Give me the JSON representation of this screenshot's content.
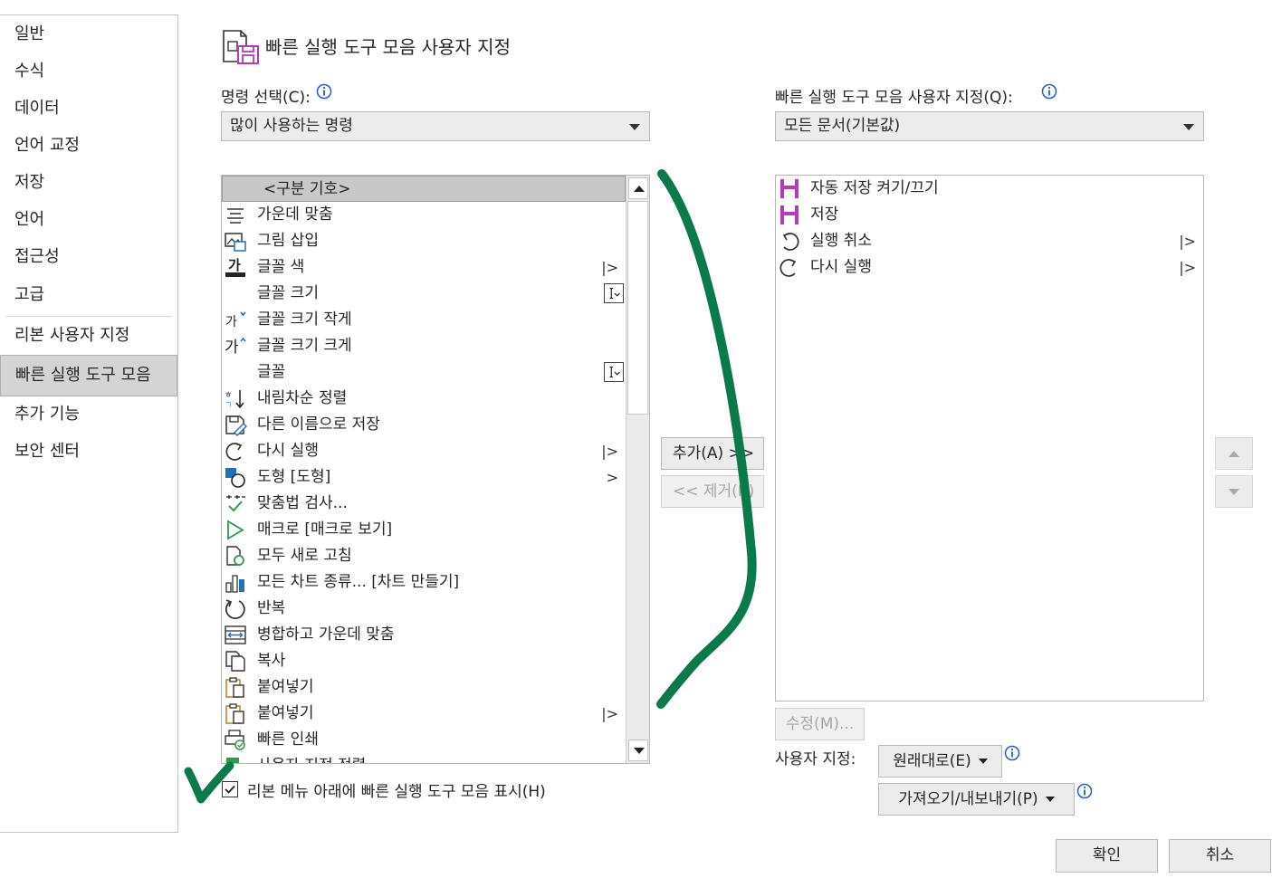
{
  "sidebar": {
    "items": [
      {
        "label": "일반"
      },
      {
        "label": "수식"
      },
      {
        "label": "데이터"
      },
      {
        "label": "언어 교정"
      },
      {
        "label": "저장"
      },
      {
        "label": "언어"
      },
      {
        "label": "접근성"
      },
      {
        "label": "고급"
      },
      {
        "label": "리본 사용자 지정"
      },
      {
        "label": "빠른 실행 도구 모음",
        "selected": true
      },
      {
        "label": "추가 기능"
      },
      {
        "label": "보안 센터"
      }
    ]
  },
  "header": {
    "title": "빠른 실행 도구 모음 사용자 지정"
  },
  "left": {
    "choose_label": "명령 선택(C):",
    "choose_value": "많이 사용하는 명령",
    "commands": [
      {
        "label": "<구분 기호>",
        "icon": "none",
        "selected": true
      },
      {
        "label": "가운데 맞춤",
        "icon": "align-center-icon"
      },
      {
        "label": "그림 삽입",
        "icon": "insert-picture-icon"
      },
      {
        "label": "글꼴 색",
        "icon": "font-color-icon",
        "extra": "|>"
      },
      {
        "label": "글꼴 크기",
        "icon": "none",
        "extra": "ctrl"
      },
      {
        "label": "글꼴 크기 작게",
        "icon": "decrease-font-icon"
      },
      {
        "label": "글꼴 크기 크게",
        "icon": "increase-font-icon"
      },
      {
        "label": "글꼴",
        "icon": "none",
        "extra": "ctrl"
      },
      {
        "label": "내림차순 정렬",
        "icon": "sort-descending-icon"
      },
      {
        "label": "다른 이름으로 저장",
        "icon": "save-as-icon"
      },
      {
        "label": "다시 실행",
        "icon": "redo-icon",
        "extra": "|>"
      },
      {
        "label": "도형 [도형]",
        "icon": "shapes-icon",
        "extra": ">"
      },
      {
        "label": "맞춤법 검사...",
        "icon": "spelling-icon"
      },
      {
        "label": "매크로 [매크로 보기]",
        "icon": "macro-icon"
      },
      {
        "label": "모두 새로 고침",
        "icon": "refresh-all-icon"
      },
      {
        "label": "모든 차트 종류... [차트 만들기]",
        "icon": "chart-icon"
      },
      {
        "label": "반복",
        "icon": "repeat-icon"
      },
      {
        "label": "병합하고 가운데 맞춤",
        "icon": "merge-center-icon"
      },
      {
        "label": "복사",
        "icon": "copy-icon"
      },
      {
        "label": "붙여넣기",
        "icon": "paste-icon"
      },
      {
        "label": "붙여넣기",
        "icon": "paste-icon",
        "extra": "|>"
      },
      {
        "label": "빠른 인쇄",
        "icon": "quick-print-icon"
      },
      {
        "label": "사용자 지정 정렬...",
        "icon": "custom-sort-icon"
      }
    ],
    "checkbox_label": "리본 메뉴 아래에 빠른 실행 도구 모음 표시(H)",
    "checkbox_checked": true
  },
  "middle": {
    "add_label": "추가(A) >>",
    "remove_label": "<< 제거(R)"
  },
  "right": {
    "customize_label": "빠른 실행 도구 모음 사용자 지정(Q):",
    "customize_value": "모든 문서(기본값)",
    "items": [
      {
        "label": "자동 저장 켜기/끄기",
        "icon": "autosave-icon"
      },
      {
        "label": "저장",
        "icon": "save-icon"
      },
      {
        "label": "실행 취소",
        "icon": "undo-icon",
        "extra": "|>"
      },
      {
        "label": "다시 실행",
        "icon": "redo-icon",
        "extra": "|>"
      }
    ],
    "modify_label": "수정(M)...",
    "custom_label": "사용자 지정:",
    "reset_label": "원래대로(E)",
    "import_export_label": "가져오기/내보내기(P)"
  },
  "footer": {
    "ok_label": "확인",
    "cancel_label": "취소"
  },
  "colors": {
    "annotation": "#0a7a4a",
    "save_purple": "#b23cb5",
    "selected_bg": "#d4d4d4"
  }
}
